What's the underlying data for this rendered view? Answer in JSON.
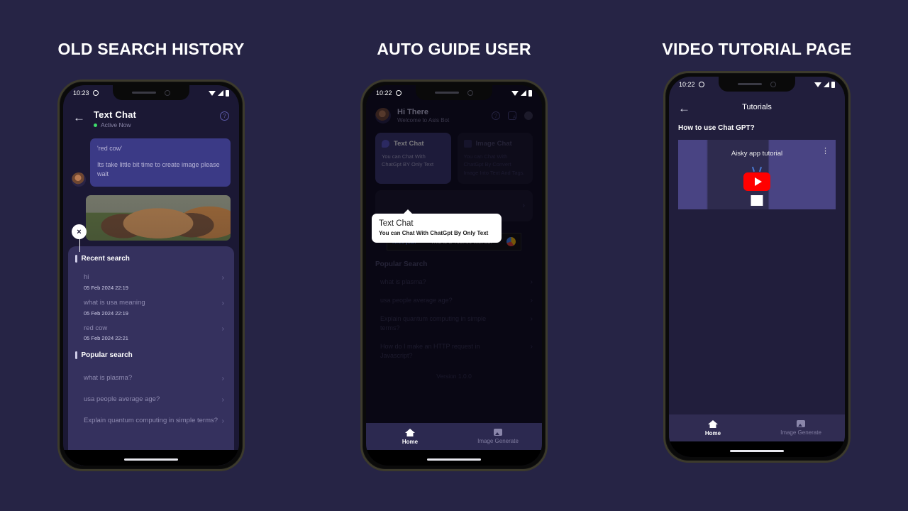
{
  "page": {
    "background": "#262445"
  },
  "panels": [
    {
      "title": "OLD SEARCH HISTORY",
      "status": {
        "time": "10:23"
      },
      "chat": {
        "back_icon": "back-arrow-icon",
        "title": "Text Chat",
        "status_text": "Active Now",
        "help_icon": "?",
        "message_line1": "'red cow'",
        "message_line2": "Its take little bit time to create image please wait",
        "close_label": "×"
      },
      "search": {
        "recent_heading": "Recent search",
        "popular_heading": "Popular search",
        "recent_items": [
          {
            "query": "hi",
            "time": "05 Feb 2024  22:19"
          },
          {
            "query": "what is usa meaning",
            "time": "05 Feb 2024  22:19"
          },
          {
            "query": "red cow",
            "time": "05 Feb 2024  22:21"
          }
        ],
        "popular_items": [
          "what is plasma?",
          "usa people average age?",
          "Explain quantum computing in simple terms?"
        ],
        "chevron": "›"
      }
    },
    {
      "title": "AUTO GUIDE USER",
      "status": {
        "time": "10:22"
      },
      "home": {
        "greeting": "Hi There",
        "subtitle": "Welcome to Asis Bot",
        "icons": [
          "help-circle-icon",
          "translate-icon",
          "sun-icon"
        ],
        "cards": [
          {
            "title": "Text Chat",
            "desc": "You can Chat With ChatGpt BY Only Text",
            "icon": "chat-bubble-icon"
          },
          {
            "title": "Image Chat",
            "desc": "You can Chat With ChatGpt By Convert Image Into Text And Tags.",
            "icon": "image-icon"
          }
        ],
        "tooltip": {
          "title": "Text Chat",
          "desc": "You can Chat With ChatGpt By Only Text"
        },
        "ad": {
          "badge": "Test Ad",
          "cta": "Nice job!",
          "text": "This is a 468x60 test ad."
        },
        "popular_heading": "Popular Search",
        "popular_items": [
          "what is plasma?",
          "usa people average age?",
          "Explain quantum computing in simple terms?",
          "How do I make an HTTP request in Javascript?"
        ],
        "version": "Version 1.0.0",
        "chevron": "›"
      },
      "nav": {
        "home": "Home",
        "image": "Image Generate"
      }
    },
    {
      "title": "VIDEO TUTORIAL PAGE",
      "status": {
        "time": "10:22"
      },
      "tutorials": {
        "back_icon": "back-arrow-icon",
        "title": "Tutorials",
        "question": "How to use Chat GPT?",
        "video_title": "Aisky app tutorial",
        "menu_icon": "⋮",
        "play_icon": "youtube-play-icon"
      },
      "nav": {
        "home": "Home",
        "image": "Image Generate"
      }
    }
  ]
}
